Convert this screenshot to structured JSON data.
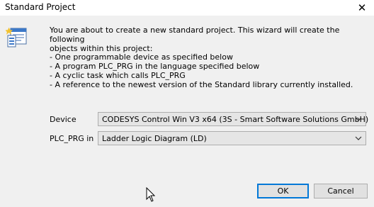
{
  "window": {
    "title": "Standard Project",
    "close_glyph": "✕"
  },
  "icon": {
    "name": "wizard-icon"
  },
  "intro_text": "You are about to create a new standard project. This wizard will create the following\nobjects within this project:",
  "bullets": [
    "- One programmable device as specified below",
    "- A program PLC_PRG in the language specified below",
    "- A cyclic task which calls PLC_PRG",
    "- A reference to the newest version of the Standard library currently installed."
  ],
  "device": {
    "label": "Device",
    "value": "CODESYS Control Win V3 x64 (3S - Smart Software Solutions GmbH)"
  },
  "plc_prg": {
    "label": "PLC_PRG in",
    "value": "Ladder Logic Diagram (LD)"
  },
  "buttons": {
    "ok": "OK",
    "cancel": "Cancel"
  },
  "colors": {
    "default_button_border": "#0078d7",
    "background": "#f0f0f0"
  }
}
